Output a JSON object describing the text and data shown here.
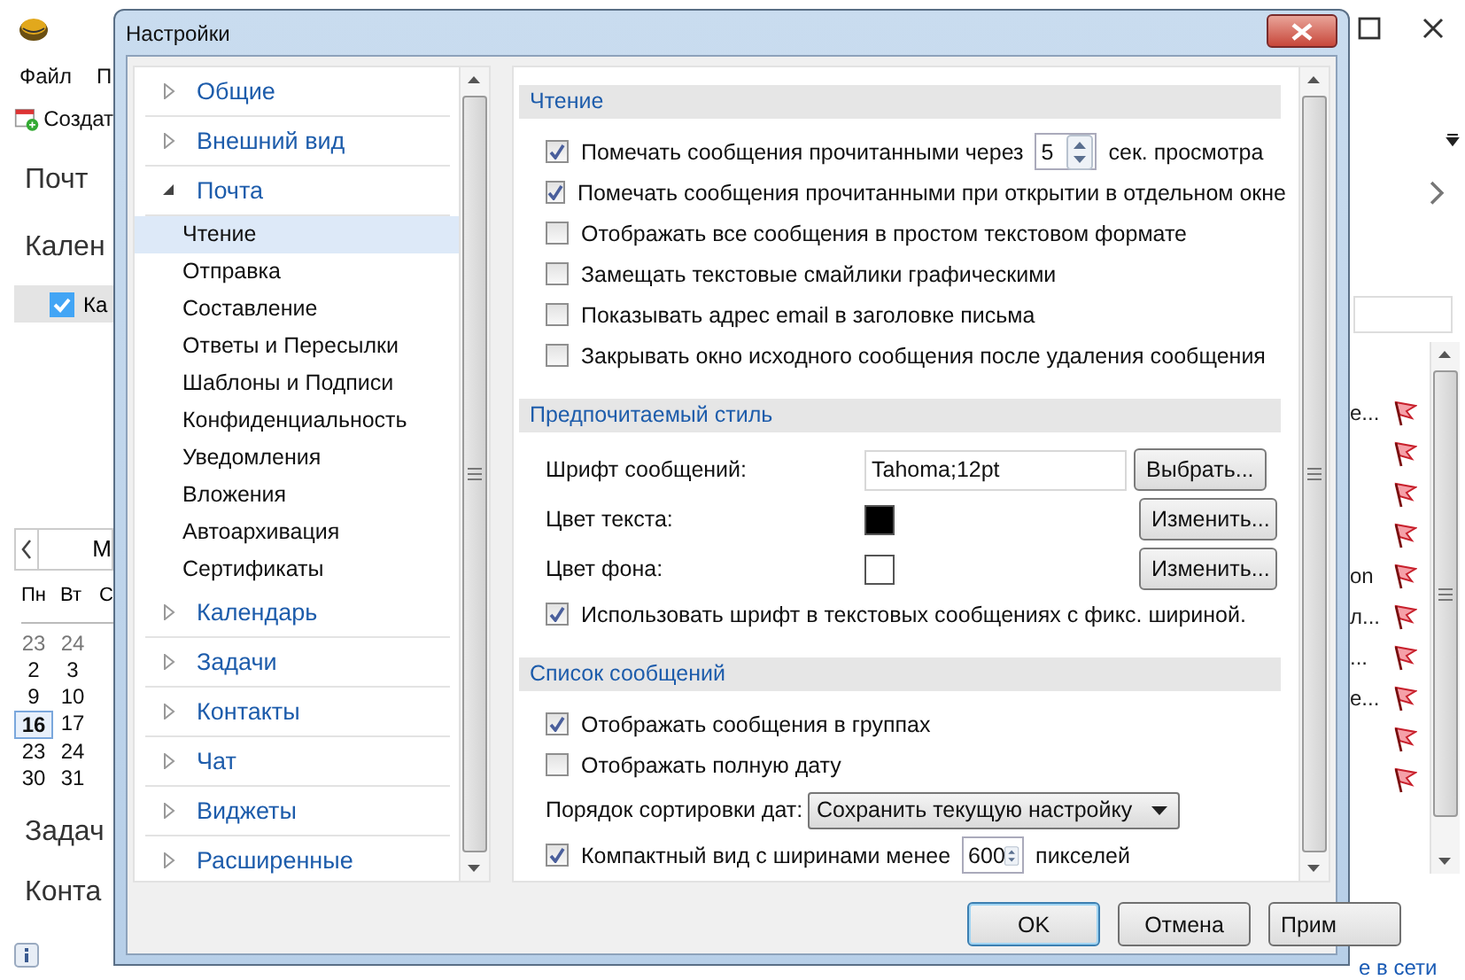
{
  "app": {
    "menu": [
      "Файл",
      "П"
    ],
    "toolbar_button": "Создат",
    "nav_top": [
      "Почт",
      "Кален"
    ],
    "calendar_item": {
      "label": "Ка",
      "checked": true
    },
    "calendar": {
      "month": "М",
      "weekdays": [
        "Пн",
        "Вт",
        "С"
      ],
      "weeks": [
        [
          {
            "day": "23",
            "other_month": true,
            "selected": false
          },
          {
            "day": "24",
            "other_month": true,
            "selected": false
          }
        ],
        [
          {
            "day": "2",
            "other_month": false,
            "selected": false
          },
          {
            "day": "3",
            "other_month": false,
            "selected": false
          }
        ],
        [
          {
            "day": "9",
            "other_month": false,
            "selected": false
          },
          {
            "day": "10",
            "other_month": false,
            "selected": false
          }
        ],
        [
          {
            "day": "16",
            "other_month": false,
            "selected": true
          },
          {
            "day": "17",
            "other_month": false,
            "selected": false
          }
        ],
        [
          {
            "day": "23",
            "other_month": false,
            "selected": false
          },
          {
            "day": "24",
            "other_month": false,
            "selected": false
          }
        ],
        [
          {
            "day": "30",
            "other_month": false,
            "selected": false
          },
          {
            "day": "31",
            "other_month": false,
            "selected": false
          }
        ]
      ]
    },
    "nav_bottom": [
      "Задач",
      "Конта"
    ],
    "message_rows": [
      {
        "text": "е...",
        "flagged": true
      },
      {
        "flagged": true
      },
      {
        "flagged": true
      },
      {
        "flagged": true
      },
      {
        "text": "on",
        "flagged": true
      },
      {
        "text": "л...",
        "flagged": true
      },
      {
        "text": "...",
        "flagged": true
      },
      {
        "text": "е...",
        "flagged": true
      },
      {
        "flagged": true
      },
      {
        "flagged": true
      }
    ],
    "status_link": "е в сети"
  },
  "dialog": {
    "title": "Настройки",
    "tree": [
      {
        "label": "Общие",
        "expanded": false
      },
      {
        "label": "Внешний вид",
        "expanded": false
      },
      {
        "label": "Почта",
        "expanded": true,
        "children": [
          {
            "label": "Чтение",
            "selected": true
          },
          {
            "label": "Отправка",
            "selected": false
          },
          {
            "label": "Составление",
            "selected": false
          },
          {
            "label": "Ответы и Пересылки",
            "selected": false
          },
          {
            "label": "Шаблоны и Подписи",
            "selected": false
          },
          {
            "label": "Конфиденциальность",
            "selected": false
          },
          {
            "label": "Уведомления",
            "selected": false
          },
          {
            "label": "Вложения",
            "selected": false
          },
          {
            "label": "Автоархивация",
            "selected": false
          },
          {
            "label": "Сертификаты",
            "selected": false
          }
        ]
      },
      {
        "label": "Календарь",
        "expanded": false
      },
      {
        "label": "Задачи",
        "expanded": false
      },
      {
        "label": "Контакты",
        "expanded": false
      },
      {
        "label": "Чат",
        "expanded": false
      },
      {
        "label": "Виджеты",
        "expanded": false
      },
      {
        "label": "Расширенные",
        "expanded": false
      }
    ],
    "sections": [
      {
        "title": "Чтение",
        "rows": [
          {
            "kind": "checkbox",
            "label": "Помечать сообщения прочитанными через",
            "checked": true,
            "spin_value": "5",
            "suffix": "сек. просмотра"
          },
          {
            "kind": "checkbox",
            "label": "Помечать сообщения прочитанными при открытии в отдельном окне",
            "checked": true
          },
          {
            "kind": "checkbox",
            "label": "Отображать все сообщения в простом текстовом формате",
            "checked": false
          },
          {
            "kind": "checkbox",
            "label": "Замещать текстовые смайлики графическими",
            "checked": false
          },
          {
            "kind": "checkbox",
            "label": "Показывать адрес email в заголовке письма",
            "checked": false
          },
          {
            "kind": "checkbox",
            "label": "Закрывать окно исходного сообщения после удаления сообщения",
            "checked": false
          }
        ]
      },
      {
        "title": "Предпочитаемый стиль",
        "rows": [
          {
            "kind": "field",
            "label": "Шрифт сообщений:",
            "value": "Tahoma;12pt",
            "button": "Выбрать..."
          },
          {
            "kind": "color",
            "label": "Цвет текста:",
            "color": "#000000",
            "button": "Изменить..."
          },
          {
            "kind": "color",
            "label": "Цвет фона:",
            "color": "#ffffff",
            "button": "Изменить..."
          },
          {
            "kind": "checkbox",
            "label": "Использовать шрифт в текстовых сообщениях с фикс. шириной.",
            "checked": true
          }
        ]
      },
      {
        "title": "Список сообщений",
        "rows": [
          {
            "kind": "checkbox",
            "label": "Отображать сообщения в группах",
            "checked": true
          },
          {
            "kind": "checkbox",
            "label": "Отображать полную дату",
            "checked": false
          },
          {
            "kind": "select",
            "label": "Порядок сортировки дат:",
            "value": "Сохранить текущую настройку"
          },
          {
            "kind": "checkbox",
            "label": "Компактный вид с ширинами менее",
            "checked": true,
            "spin_value": "600",
            "suffix": "пикселей"
          }
        ]
      }
    ],
    "buttons": [
      {
        "label": "OK",
        "default": true
      },
      {
        "label": "Отмена",
        "default": false
      },
      {
        "label": "Прим",
        "default": false
      }
    ]
  }
}
